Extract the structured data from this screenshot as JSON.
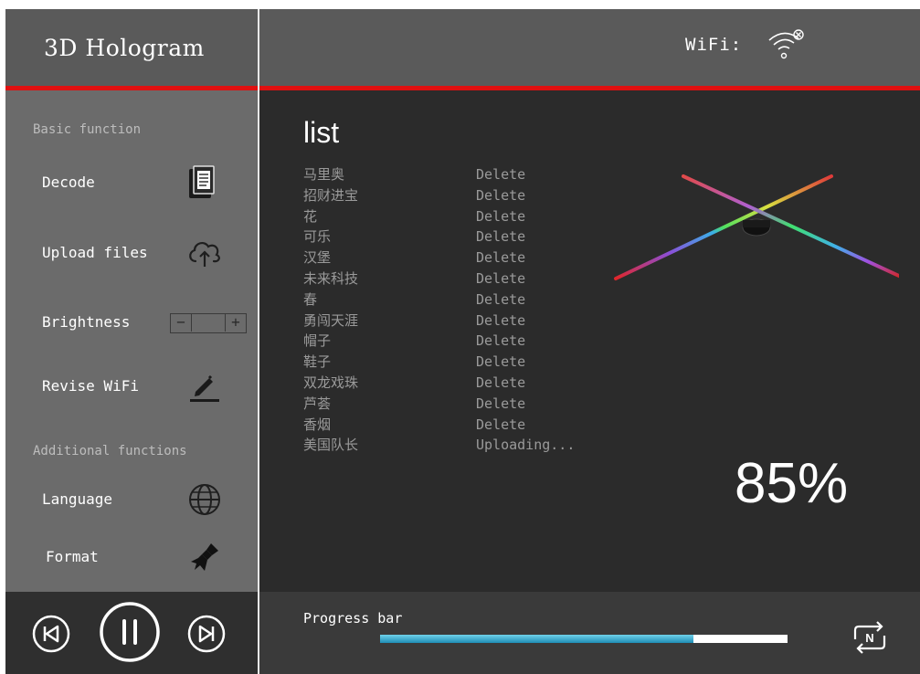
{
  "app": {
    "title": "3D Hologram",
    "accent": "#e01010"
  },
  "sidebar": {
    "basic_section": "Basic function",
    "basic_items": [
      {
        "label": "Decode",
        "icon": "document-icon"
      },
      {
        "label": "Upload files",
        "icon": "cloud-upload-icon"
      },
      {
        "label": "Brightness",
        "icon": "brightness-stepper"
      },
      {
        "label": "Revise WiFi",
        "icon": "edit-pencil-icon"
      }
    ],
    "additional_section": "Additional functions",
    "additional_items": [
      {
        "label": "Language",
        "icon": "globe-icon"
      },
      {
        "label": "Format",
        "icon": "brush-icon"
      }
    ],
    "brightness": {
      "minus": "−",
      "plus": "+"
    }
  },
  "player": {
    "buttons": [
      "previous-icon",
      "pause-icon",
      "next-icon"
    ]
  },
  "header": {
    "wifi_label": "WiFi:",
    "wifi_icon": "wifi-disconnected-icon"
  },
  "main": {
    "list_title": "list",
    "files": [
      {
        "name": "马里奥",
        "action": "Delete"
      },
      {
        "name": "招财进宝",
        "action": "Delete"
      },
      {
        "name": "花",
        "action": "Delete"
      },
      {
        "name": "可乐",
        "action": "Delete"
      },
      {
        "name": "汉堡",
        "action": "Delete"
      },
      {
        "name": "未来科技",
        "action": "Delete"
      },
      {
        "name": "春",
        "action": "Delete"
      },
      {
        "name": "勇闯天涯",
        "action": "Delete"
      },
      {
        "name": "帽子",
        "action": "Delete"
      },
      {
        "name": "鞋子",
        "action": "Delete"
      },
      {
        "name": "双龙戏珠",
        "action": "Delete"
      },
      {
        "name": "芦荟",
        "action": "Delete"
      },
      {
        "name": "香烟",
        "action": "Delete"
      },
      {
        "name": "美国队长",
        "action": "Uploading..."
      }
    ],
    "upload_percent": "85%",
    "progress_label": "Progress bar",
    "progress_fraction": 0.77,
    "loop_icon": "loop-n-icon"
  }
}
